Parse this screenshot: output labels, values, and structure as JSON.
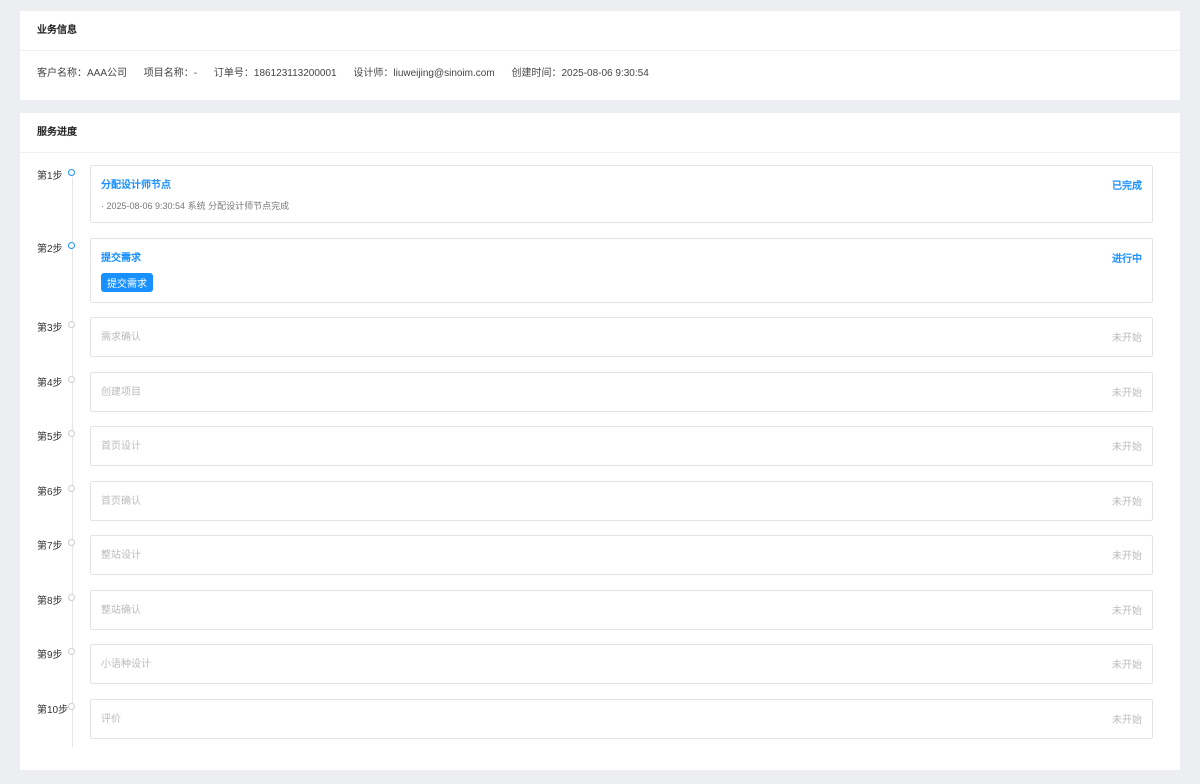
{
  "business": {
    "title": "业务信息",
    "fields": [
      "客户名称：AAA公司",
      "项目名称：-",
      "订单号：186123113200001",
      "设计师：liuweijing@sinoim.com",
      "创建时间：2025-08-06 9:30:54"
    ]
  },
  "progress": {
    "title": "服务进度",
    "steps": [
      {
        "label": "第1步",
        "title": "分配设计师节点",
        "status": "已完成",
        "active": true,
        "log": "· 2025-08-06 9:30:54 系统 分配设计师节点完成"
      },
      {
        "label": "第2步",
        "title": "提交需求",
        "status": "进行中",
        "active": true,
        "button": "提交需求"
      },
      {
        "label": "第3步",
        "title": "需求确认",
        "status": "未开始"
      },
      {
        "label": "第4步",
        "title": "创建项目",
        "status": "未开始"
      },
      {
        "label": "第5步",
        "title": "首页设计",
        "status": "未开始"
      },
      {
        "label": "第6步",
        "title": "首页确认",
        "status": "未开始"
      },
      {
        "label": "第7步",
        "title": "整站设计",
        "status": "未开始"
      },
      {
        "label": "第8步",
        "title": "整站确认",
        "status": "未开始"
      },
      {
        "label": "第9步",
        "title": "小语种设计",
        "status": "未开始"
      },
      {
        "label": "第10步",
        "title": "评价",
        "status": "未开始"
      }
    ]
  }
}
